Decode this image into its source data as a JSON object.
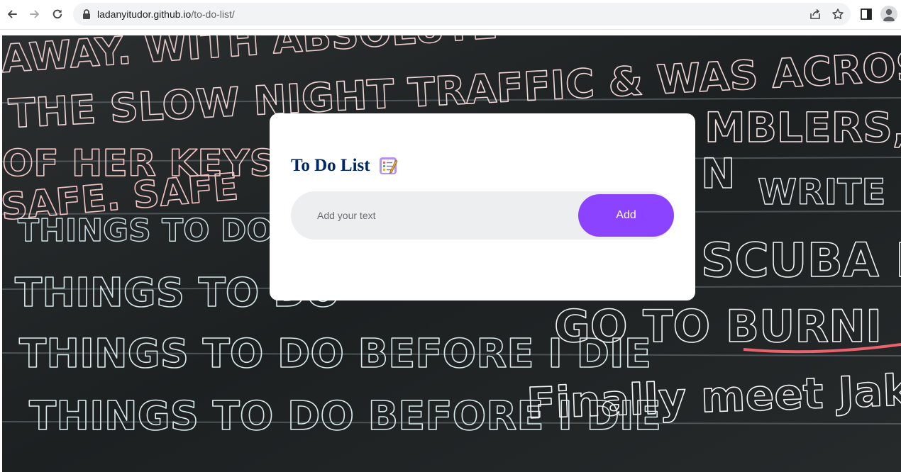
{
  "browser": {
    "url_host": "ladanyitudor.github.io",
    "url_path": "/to-do-list/",
    "icons": [
      "back-arrow-icon",
      "forward-arrow-icon",
      "reload-icon",
      "lock-icon",
      "share-icon",
      "star-icon",
      "side-panel-icon",
      "profile-avatar-icon"
    ]
  },
  "app": {
    "title": "To Do List",
    "title_icon": "notepad-checklist-icon",
    "input_placeholder": "Add your text",
    "add_button_label": "Add",
    "tasks": []
  },
  "background": {
    "chalk_text": [
      "AWAY. WITH ABSOLUTE",
      "THE SLOW NIGHT TRAFFIC & WAS ACROSS. TH",
      "OF HER KEYS",
      "MBLERS,",
      "SAFE. SAFE",
      "N",
      "WRITE",
      "THINGS TO DO",
      "SCUBA D",
      "THINGS TO DO",
      "THINGS TO DO BEFORE I DIE",
      "GO TO BURNI",
      "THINGS TO DO BEFORE I DIE",
      "Finally meet Jak"
    ]
  },
  "colors": {
    "title": "#002765",
    "add_button": "#8c43ff",
    "input_bg": "#edeef0",
    "chalkboard": "#1d2122"
  }
}
